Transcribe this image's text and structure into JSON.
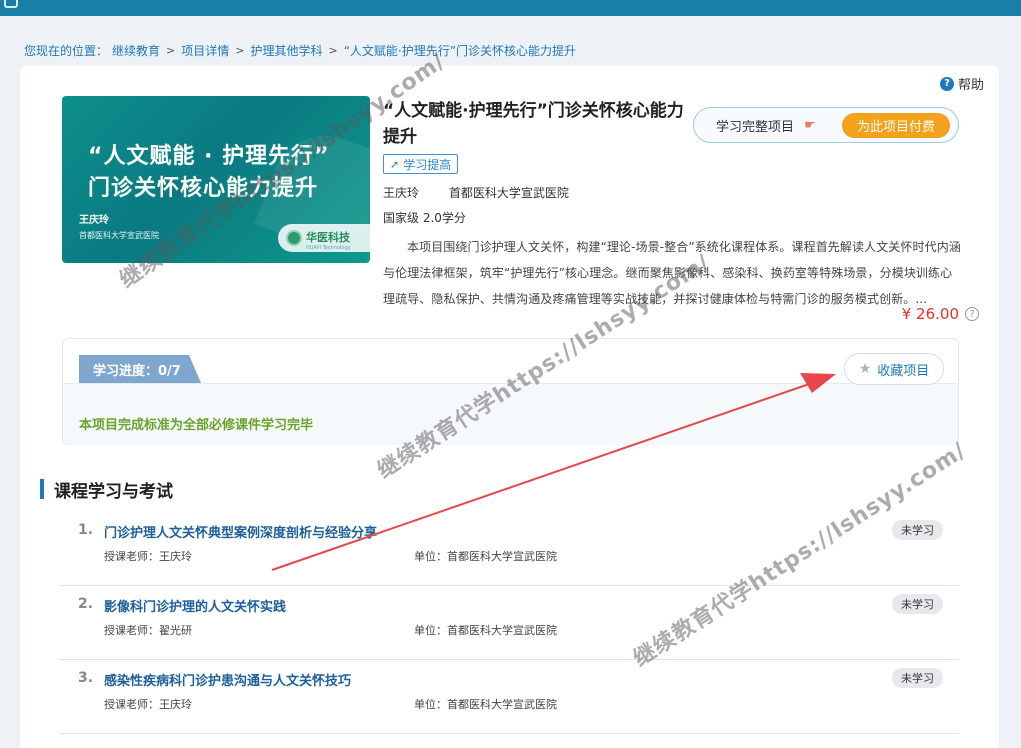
{
  "breadcrumb": {
    "lead": "您现在的位置：",
    "items": [
      "继续教育",
      "项目详情",
      "护理其他学科",
      "“人文赋能·护理先行”门诊关怀核心能力提升"
    ],
    "separator": ">"
  },
  "help": {
    "label": "帮助",
    "icon": "question-circle-icon"
  },
  "cover": {
    "line1": "“人文赋能 · 护理先行”",
    "line2": "门诊关怀核心能力提升",
    "author": "王庆玲",
    "org": "首都医科大学宣武医院",
    "brand": "华医科技",
    "brand_sub": "HUAYI Technology"
  },
  "project": {
    "title": "“人文赋能·护理先行”门诊关怀核心能力提升",
    "tag": "学习提高",
    "teacher": "王庆玲",
    "organization": "首都医科大学宣武医院",
    "credit": "国家级 2.0学分",
    "description": "本项目围绕门诊护理人文关怀，构建“理论-场景-整合”系统化课程体系。课程首先解读人文关怀时代内涵与伦理法律框架，筑牢“护理先行”核心理念。继而聚焦影像科、感染科、换药室等特殊场景，分模块训练心理疏导、隐私保护、共情沟通及疼痛管理等实战技能，并探讨健康体检与特需门诊的服务模式创新。...",
    "price": "¥ 26.00"
  },
  "purchase": {
    "label": "学习完整项目",
    "pay_button": "为此项目付费",
    "colors": {
      "pay": "#f4a21b"
    }
  },
  "progress": {
    "label": "学习进度：0/7",
    "completed": 0,
    "total": 7,
    "favorite_button": "收藏项目",
    "completion_rule": "本项目完成标准为全部必修课件学习完毕"
  },
  "section": {
    "title": "课程学习与考试"
  },
  "courses": [
    {
      "num": "1.",
      "title": "门诊护理人文关怀典型案例深度剖析与经验分享",
      "teacher_label": "授课老师：",
      "teacher": "王庆玲",
      "unit_label": "单位：",
      "unit": "首都医科大学宣武医院",
      "status": "未学习"
    },
    {
      "num": "2.",
      "title": "影像科门诊护理的人文关怀实践",
      "teacher_label": "授课老师：",
      "teacher": "翟光研",
      "unit_label": "单位：",
      "unit": "首都医科大学宣武医院",
      "status": "未学习"
    },
    {
      "num": "3.",
      "title": "感染性疾病科门诊护患沟通与人文关怀技巧",
      "teacher_label": "授课老师：",
      "teacher": "王庆玲",
      "unit_label": "单位：",
      "unit": "首都医科大学宣武医院",
      "status": "未学习"
    }
  ],
  "watermarks": [
    "继续教育代学https://lshsyy.com/",
    "继续教育代学https://lshsyy.com/",
    "继续教育代学https://lshsyy.com/"
  ],
  "colors": {
    "accent": "#1d78c0",
    "price": "#e4312b",
    "rule": "#6ba32a",
    "arrow": "#e8474a"
  }
}
